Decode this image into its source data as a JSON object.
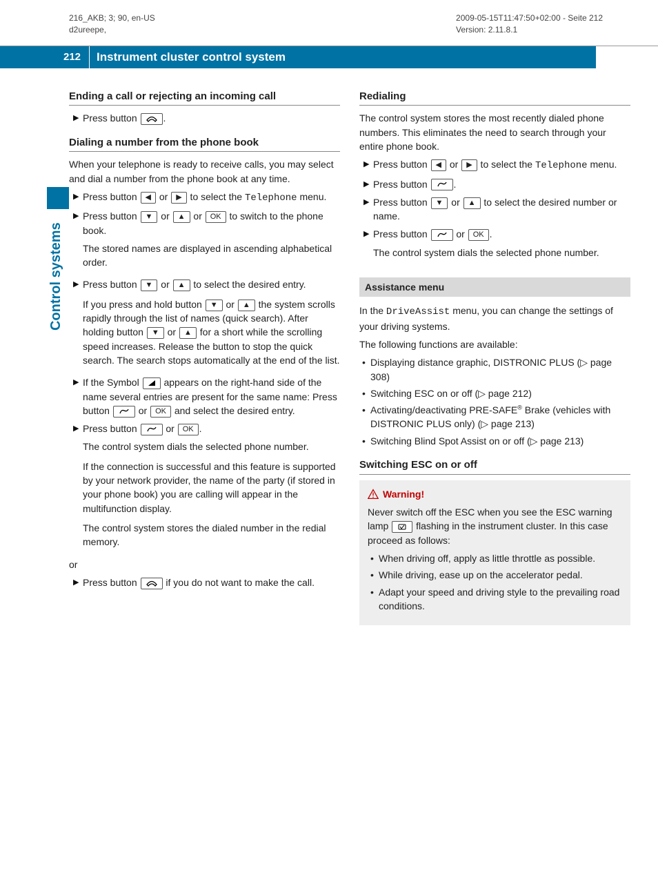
{
  "meta": {
    "left1": "216_AKB; 3; 90, en-US",
    "left2": "d2ureepe,",
    "right1": "2009-05-15T11:47:50+02:00 - Seite 212",
    "right2": "Version: 2.11.8.1"
  },
  "bar": {
    "page": "212",
    "title": "Instrument cluster control system"
  },
  "side_label": "Control systems",
  "col1": {
    "h1": "Ending a call or rejecting an incoming call",
    "s1": "Press button ",
    "s1b": ".",
    "h2": "Dialing a number from the phone book",
    "intro": "When your telephone is ready to receive calls, you may select and dial a number from the phone book at any time.",
    "p1a": "Press button ",
    "p1b": " or ",
    "p1c": " to select the ",
    "p1menu": "Telephone",
    "p1d": " menu.",
    "p2a": "Press button ",
    "p2b": " or ",
    "p2c": " or ",
    "p2d": " to switch to the phone book.",
    "p2e": "The stored names are displayed in ascending alphabetical order.",
    "p3a": "Press button ",
    "p3b": " or ",
    "p3c": " to select the desired entry.",
    "p3d1": "If you press and hold button ",
    "p3d2": " or ",
    "p3d3": " the system scrolls rapidly through the list of names (quick search). After holding button ",
    "p3d4": " or ",
    "p3d5": " for a short while the scrolling speed increases. Release the button to stop the quick search. The search stops automatically at the end of the list.",
    "p4a": "If the Symbol ",
    "p4b": " appears on the right-hand side of the name several entries are present for the same name: Press button ",
    "p4c": " or ",
    "p4d": " and select the desired entry.",
    "p5a": "Press button ",
    "p5b": " or ",
    "p5c": ".",
    "p5d": "The control system dials the selected phone number.",
    "p5e": "If the connection is successful and this feature is supported by your network provider, the name of the party (if stored in your phone book) you are calling will appear in the multifunction display.",
    "p5f": "The control system stores the dialed number in the redial memory.",
    "or": "or",
    "p6a": "Press button ",
    "p6b": " if you do not want to make the call."
  },
  "col2": {
    "h1": "Redialing",
    "intro": "The control system stores the most recently dialed phone numbers. This eliminates the need to search through your entire phone book.",
    "r1a": "Press button ",
    "r1b": " or ",
    "r1c": " to select the ",
    "r1menu": "Telephone",
    "r1d": " menu.",
    "r2a": "Press button ",
    "r2b": ".",
    "r3a": "Press button ",
    "r3b": " or ",
    "r3c": " to select the desired number or name.",
    "r4a": "Press button ",
    "r4b": " or ",
    "r4c": ".",
    "r4d": "The control system dials the selected phone number.",
    "assist_head": "Assistance menu",
    "assist_intro1a": "In the ",
    "assist_menu": "DriveAssist",
    "assist_intro1b": " menu, you can change the settings of your driving systems.",
    "assist_intro2": "The following functions are available:",
    "b1": "Displaying distance graphic, DISTRONIC PLUS (▷ page 308)",
    "b2": "Switching ESC on or off (▷ page 212)",
    "b3a": "Activating/deactivating PRE-SAFE",
    "b3b": " Brake (vehicles with DISTRONIC PLUS only) (▷ page 213)",
    "b4": "Switching Blind Spot Assist on or off (▷ page 213)",
    "h_esc": "Switching ESC on or off",
    "warn_title": "Warning!",
    "warn_p1a": "Never switch off the ESC when you see the ESC warning lamp ",
    "warn_p1b": " flashing in the instrument cluster. In this case proceed as follows:",
    "w1": "When driving off, apply as little throttle as possible.",
    "w2": "While driving, ease up on the accelerator pedal.",
    "w3": "Adapt your speed and driving style to the prevailing road conditions."
  },
  "icons": {
    "ok": "OK"
  }
}
